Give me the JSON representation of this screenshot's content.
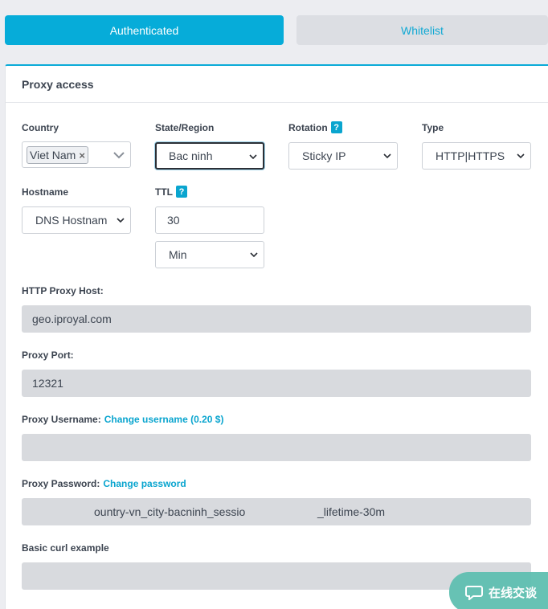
{
  "tabs": {
    "authenticated": "Authenticated",
    "whitelist": "Whitelist"
  },
  "card": {
    "title": "Proxy access"
  },
  "fields": {
    "country": {
      "label": "Country",
      "selected": "Viet Nam",
      "remove": "×"
    },
    "state": {
      "label": "State/Region",
      "value": "Bac ninh"
    },
    "rotation": {
      "label": "Rotation",
      "help": "?",
      "value": "Sticky IP"
    },
    "type": {
      "label": "Type",
      "value": "HTTP|HTTPS"
    },
    "hostname": {
      "label": "Hostname",
      "value": "DNS Hostnam"
    },
    "ttl": {
      "label": "TTL",
      "help": "?",
      "value": "30",
      "unit": "Min"
    }
  },
  "proxy": {
    "host_label": "HTTP Proxy Host:",
    "host_value": "geo.iproyal.com",
    "port_label": "Proxy Port:",
    "port_value": "12321",
    "username_label": "Proxy Username:",
    "username_link": "Change username (0.20 $)",
    "username_value": "",
    "password_label": "Proxy Password:",
    "password_link": "Change password",
    "password_part1": "ountry-vn_city-bacninh_sessio",
    "password_part2": "_lifetime-30m",
    "curl_label": "Basic curl example"
  },
  "chat": {
    "label": "在线交谈",
    "icon": "chat-bubble-icon"
  },
  "colors": {
    "accent": "#06acd9",
    "link": "#0aa5cf",
    "readonly_bg": "#d8dade"
  }
}
